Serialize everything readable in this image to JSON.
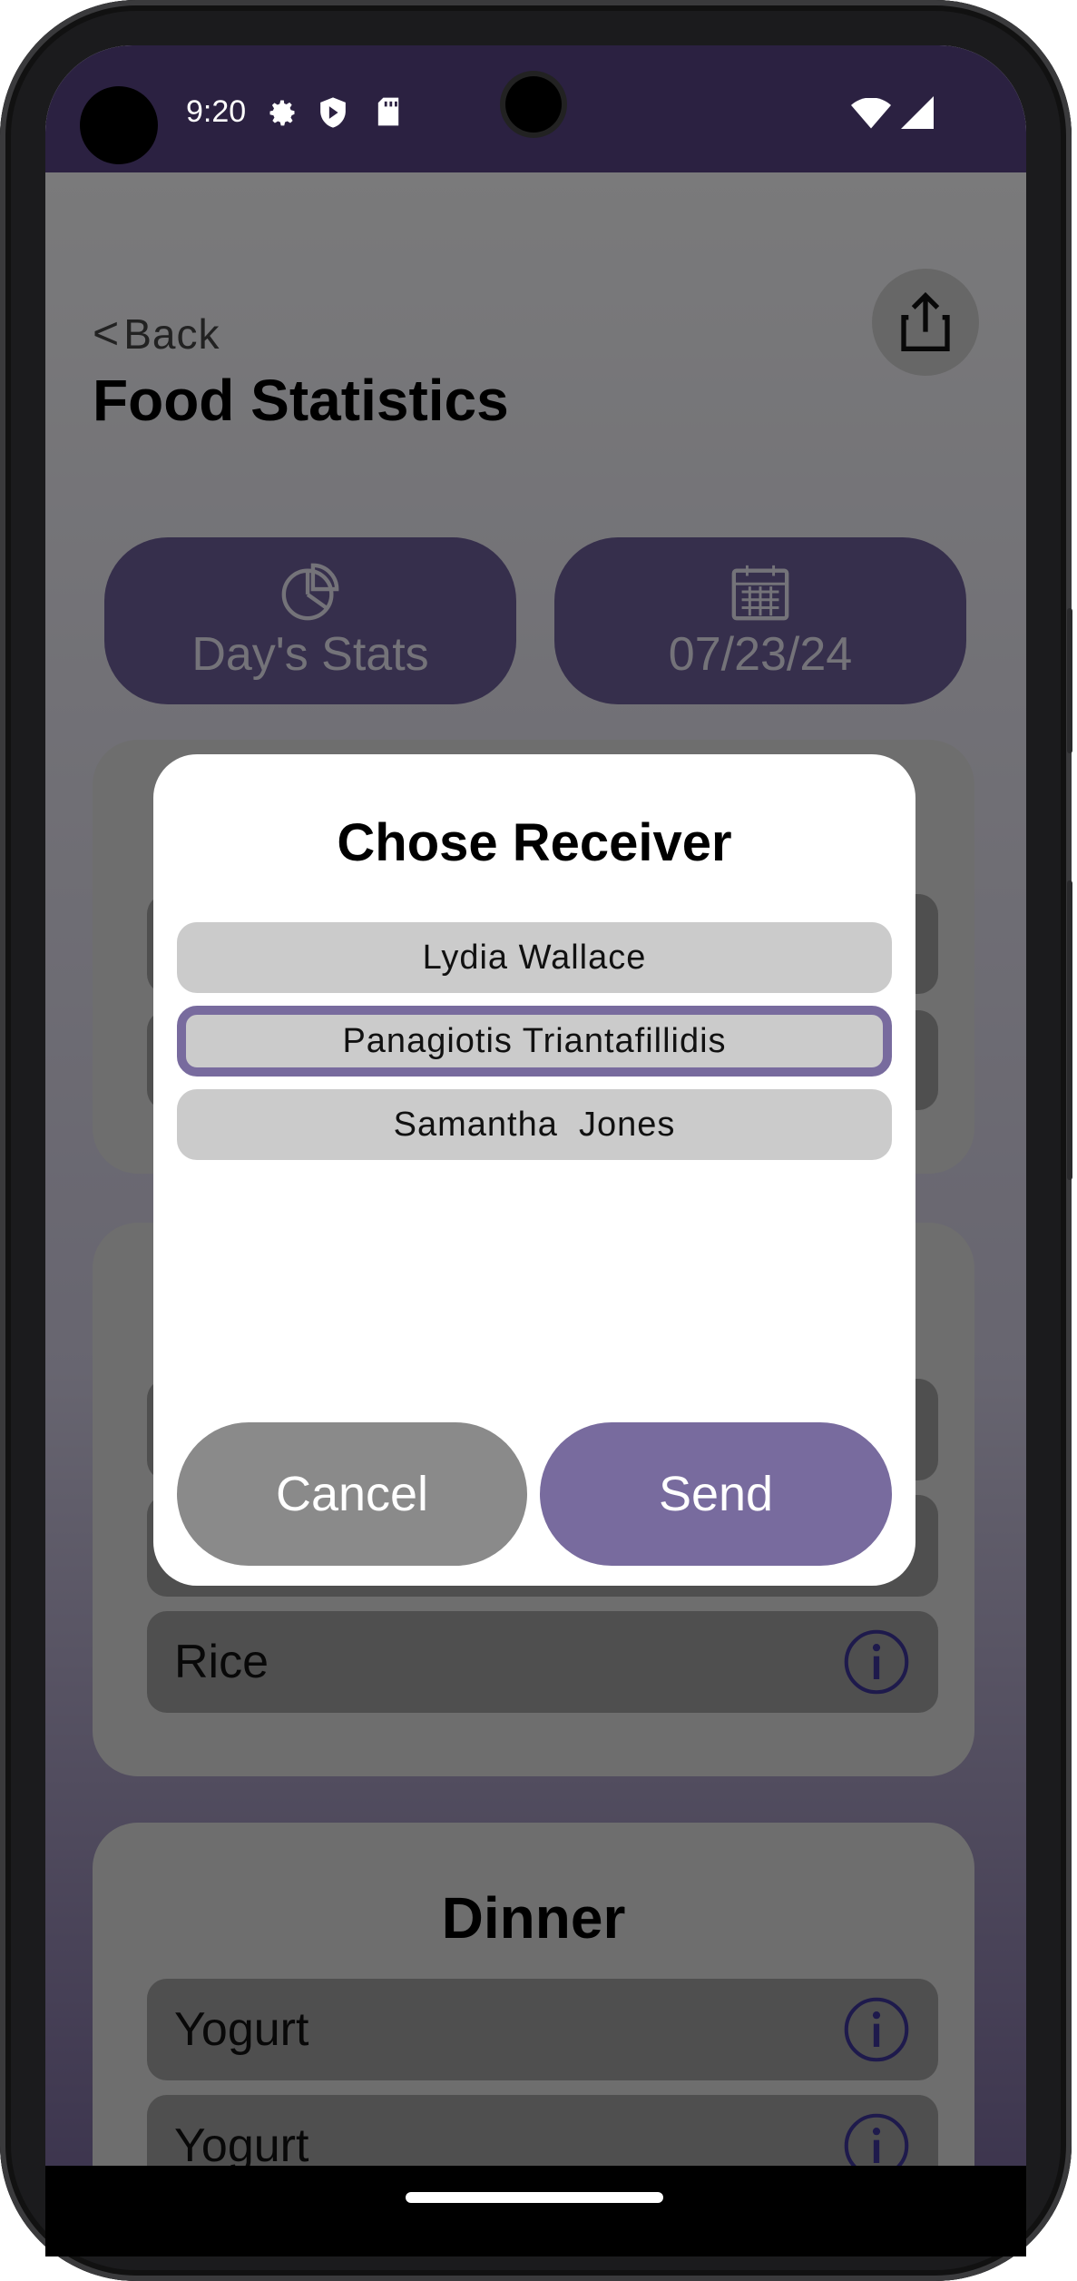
{
  "status_bar": {
    "time": "9:20",
    "icons": [
      "settings-icon",
      "shield-icon",
      "sd-card-icon",
      "wifi-icon",
      "signal-icon"
    ]
  },
  "header": {
    "back_label": "Back",
    "back_chevron": "<",
    "title": "Food Statistics",
    "share_icon": "share-icon"
  },
  "filters": {
    "stats_label": "Day's Stats",
    "date_label": "07/23/24"
  },
  "lunch_card": {
    "items": [
      {
        "name": "Rice"
      }
    ]
  },
  "dinner_card": {
    "title": "Dinner",
    "items": [
      {
        "name": "Yogurt"
      },
      {
        "name": "Yogurt"
      }
    ]
  },
  "dialog": {
    "title": "Chose Receiver",
    "receivers": [
      {
        "name": "Lydia Wallace",
        "selected": false
      },
      {
        "name": "Panagiotis Triantafillidis",
        "selected": true
      },
      {
        "name": "Samantha  Jones",
        "selected": false
      }
    ],
    "cancel_label": "Cancel",
    "send_label": "Send"
  },
  "colors": {
    "accent": "#786b9e",
    "status_bar": "#2b2141",
    "pill": "#6d5e98"
  }
}
